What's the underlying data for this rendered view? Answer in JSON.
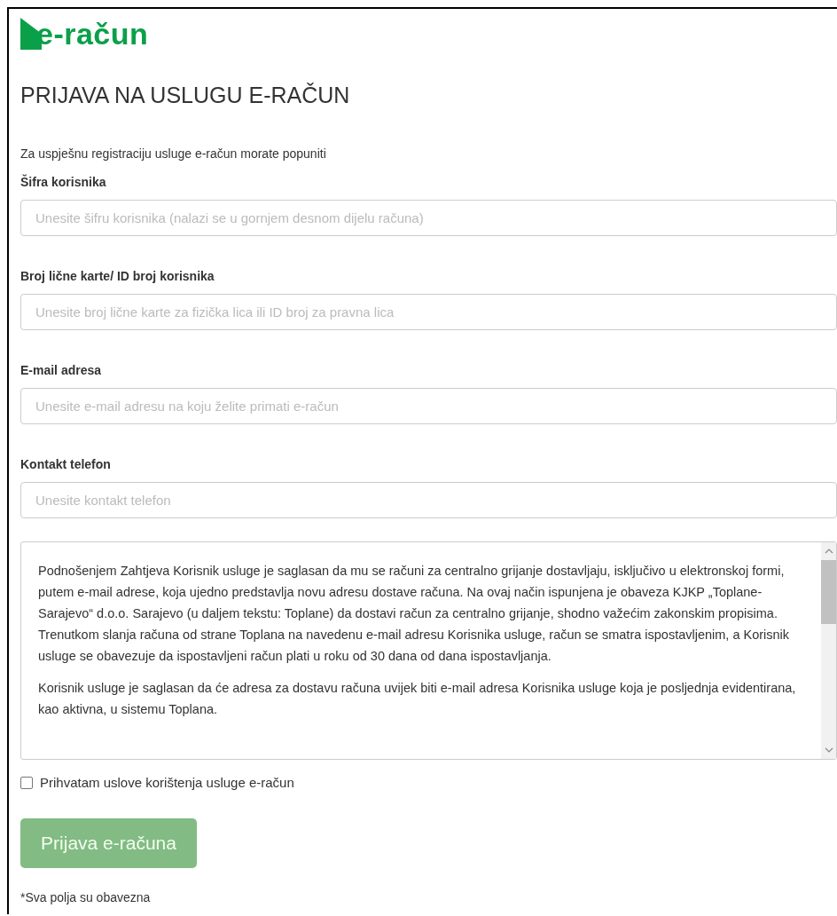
{
  "logo": {
    "text": "e-račun"
  },
  "title": "PRIJAVA NA USLUGU E-RAČUN",
  "intro": "Za uspješnu registraciju usluge e-račun morate popuniti",
  "fields": [
    {
      "label": "Šifra korisnika",
      "placeholder": "Unesite šifru korisnika (nalazi se u gornjem desnom dijelu računa)"
    },
    {
      "label": "Broj lične karte/ ID broj korisnika",
      "placeholder": "Unesite broj lične karte za fizička lica ili ID broj za pravna lica"
    },
    {
      "label": "E-mail adresa",
      "placeholder": "Unesite e-mail adresu na koju želite primati e-račun"
    },
    {
      "label": "Kontakt telefon",
      "placeholder": "Unesite kontakt telefon"
    }
  ],
  "terms": {
    "paragraphs": [
      "Podnošenjem Zahtjeva Korisnik usluge je saglasan da mu se računi za centralno grijanje dostavljaju, isključivo u elektronskoj formi, putem e-mail adrese, koja ujedno predstavlja novu adresu dostave računa. Na ovaj način ispunjena je obaveza KJKP „Toplane-Sarajevo“ d.o.o. Sarajevo (u daljem tekstu: Toplane) da dostavi račun za centralno grijanje, shodno važećim zakonskim propisima. Trenutkom slanja računa od strane Toplana na navedenu e-mail adresu Korisnika usluge, račun se smatra ispostavljenim, a Korisnik usluge se obavezuje da ispostavljeni račun plati u roku od 30 dana od dana ispostavljanja.",
      "Korisnik usluge je saglasan da će adresa za dostavu računa uvijek biti e-mail adresa Korisnika usluge koja je posljednja evidentirana, kao aktivna, u sistemu Toplana."
    ]
  },
  "accept": {
    "label": "Prihvatam uslove korištenja usluge e-račun",
    "checked": false
  },
  "submit": {
    "label": "Prijava e-računa",
    "disabled": true
  },
  "footnote": "*Sva polja su obavezna"
}
